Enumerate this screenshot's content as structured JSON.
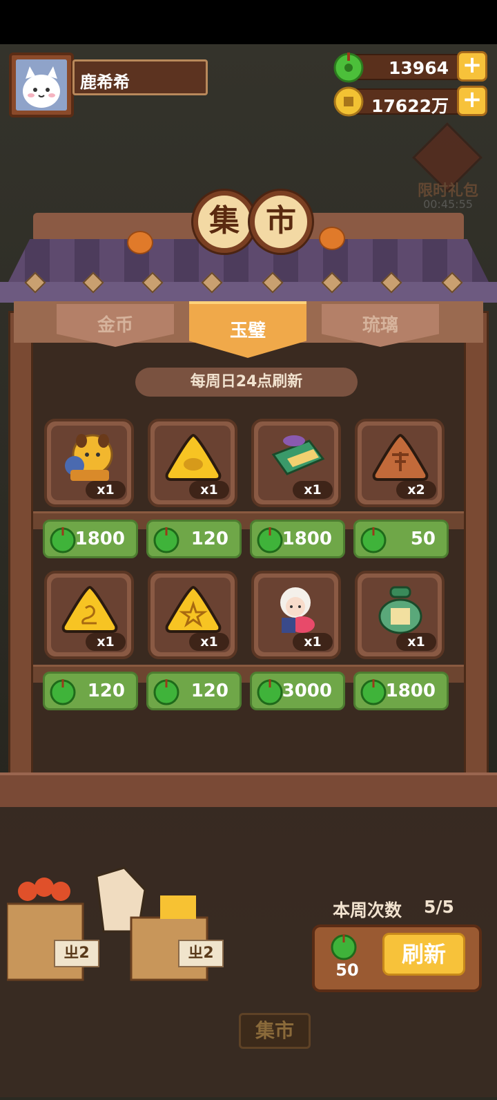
{
  "player": {
    "name": "鹿希希"
  },
  "currencies": {
    "jade": {
      "value": "13964",
      "icon": "jade-coin-icon",
      "color": "#4cbf3a"
    },
    "gold": {
      "value": "17622万",
      "icon": "gold-coin-icon",
      "color": "#f2c233"
    },
    "plus_symbol": "+"
  },
  "gift": {
    "title": "限时礼包",
    "timer": "00:45:55"
  },
  "shop": {
    "title_chars": [
      "集",
      "市"
    ],
    "tabs": [
      {
        "label": "金币",
        "active": false
      },
      {
        "label": "玉璧",
        "active": true
      },
      {
        "label": "琉璃",
        "active": false
      }
    ],
    "refresh_note": "每周日24点刷新",
    "items": [
      {
        "art": "dog-character-icon",
        "qty": "x1",
        "price": "1800"
      },
      {
        "art": "yellow-fish-token-icon",
        "qty": "x1",
        "price": "120"
      },
      {
        "art": "green-gift-box-icon",
        "qty": "x1",
        "price": "1800"
      },
      {
        "art": "brown-glyph-token-icon",
        "qty": "x2",
        "price": "50"
      },
      {
        "art": "yellow-swirl-token-icon",
        "qty": "x1",
        "price": "120"
      },
      {
        "art": "yellow-star-token-icon",
        "qty": "x1",
        "price": "120"
      },
      {
        "art": "white-hair-character-icon",
        "qty": "x1",
        "price": "3000"
      },
      {
        "art": "green-scroll-bag-icon",
        "qty": "x1",
        "price": "1800"
      }
    ]
  },
  "weekly": {
    "label": "本周次数",
    "value": "5/5"
  },
  "refresh": {
    "cost": "50",
    "label": "刷新"
  },
  "bottom_sign": "集市",
  "merchant_signs": [
    "ㄓ2",
    "ㄓ2"
  ]
}
